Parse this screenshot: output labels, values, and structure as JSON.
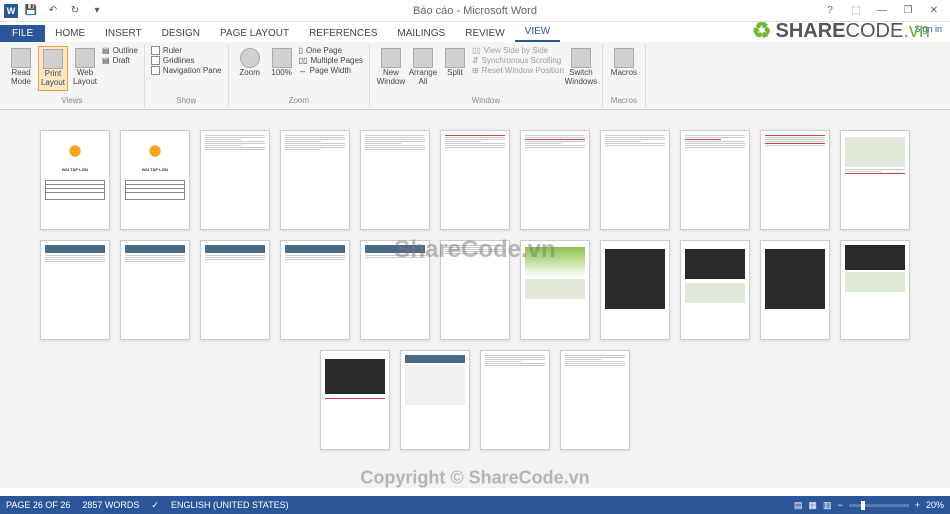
{
  "titlebar": {
    "title": "Báo cáo - Microsoft Word",
    "help": "?",
    "ribbon_opts": "⬚",
    "minimize": "—",
    "restore": "❐",
    "close": "✕"
  },
  "qat": {
    "save": "💾",
    "undo": "↶",
    "redo": "↻",
    "touch": "⬚"
  },
  "tabs": {
    "file": "FILE",
    "home": "HOME",
    "insert": "INSERT",
    "design": "DESIGN",
    "page_layout": "PAGE LAYOUT",
    "references": "REFERENCES",
    "mailings": "MAILINGS",
    "review": "REVIEW",
    "view": "VIEW",
    "signin": "Sign in"
  },
  "ribbon": {
    "views": {
      "read_mode": "Read Mode",
      "print_layout": "Print Layout",
      "web_layout": "Web Layout",
      "outline": "Outline",
      "draft": "Draft",
      "group": "Views"
    },
    "show": {
      "ruler": "Ruler",
      "gridlines": "Gridlines",
      "nav_pane": "Navigation Pane",
      "group": "Show"
    },
    "zoom": {
      "zoom": "Zoom",
      "hundred": "100%",
      "one_page": "One Page",
      "multi_pages": "Multiple Pages",
      "page_width": "Page Width",
      "group": "Zoom"
    },
    "window": {
      "new_window": "New Window",
      "arrange_all": "Arrange All",
      "split": "Split",
      "side_by_side": "View Side by Side",
      "sync_scroll": "Synchronous Scrolling",
      "reset_pos": "Reset Window Position",
      "switch": "Switch Windows",
      "group": "Window"
    },
    "macros": {
      "macros": "Macros",
      "group": "Macros"
    }
  },
  "logo": {
    "brand": "SHARE",
    "sub": "CODE",
    "tld": ".vn"
  },
  "watermark": {
    "center": "ShareCode.vn",
    "copyright": "Copyright © ShareCode.vn"
  },
  "thumbs": {
    "cover_title": "BÀI TẬP LỚN"
  },
  "status": {
    "page": "PAGE 26 OF 26",
    "words": "2857 WORDS",
    "lang": "ENGLISH (UNITED STATES)",
    "zoom": "20%"
  }
}
